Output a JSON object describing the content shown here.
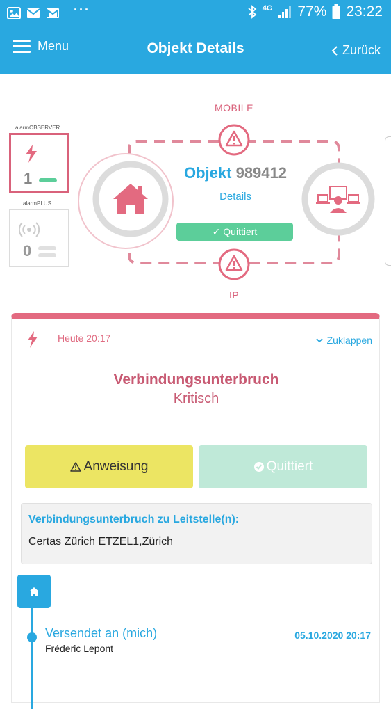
{
  "status_bar": {
    "battery": "77%",
    "time": "23:22",
    "network": "4G",
    "dots": "···",
    "icons": [
      "image-icon",
      "mail-icon",
      "gmail-icon",
      "bluetooth-icon",
      "signal-icon",
      "battery-icon"
    ]
  },
  "header": {
    "menu_label": "Menu",
    "title": "Objekt Details",
    "back_label": "Zurück"
  },
  "diagram": {
    "observer": {
      "label": "alarmOBSERVER",
      "count": "1",
      "color": "#d9627b"
    },
    "plus": {
      "label": "alarmPLUS",
      "count": "0"
    },
    "mobile_label": "MOBILE",
    "ip_label": "IP",
    "object_word": "Objekt",
    "object_id": "989412",
    "details_link": "Details",
    "status": "✓ Quittiert"
  },
  "alarm_card": {
    "time": "Heute 20:17",
    "collapse_label": "Zuklappen",
    "event_title": "Verbindungsunterbruch",
    "event_severity": "Kritisch",
    "instruction_button": "Anweisung",
    "acknowledged_button": "Quittiert",
    "info_heading": "Verbindungsunterbruch zu Leitstelle(n):",
    "info_text": "Certas Zürich ETZEL1,Zürich",
    "timeline": {
      "title": "Versendet an (mich)",
      "person": "Fréderic Lepont",
      "date": "05.10.2020 20:17"
    }
  },
  "colors": {
    "primary": "#29a8e0",
    "alarm": "#d9627b",
    "ack_green": "#5cce9a",
    "instruction_yellow": "#ece563"
  }
}
